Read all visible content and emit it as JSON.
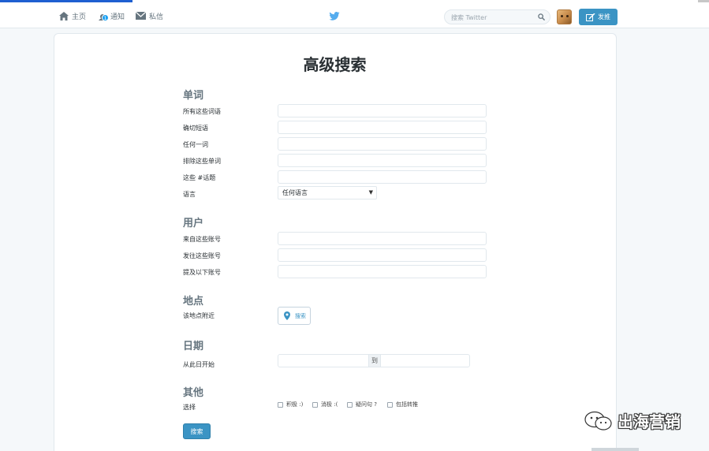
{
  "nav": {
    "home_label": "主页",
    "notifications_label": "通知",
    "notifications_badge": "1",
    "messages_label": "私信"
  },
  "search": {
    "placeholder": "搜索 Twitter"
  },
  "tweet_button_label": "发推",
  "page_title": "高级搜索",
  "sections": {
    "words": {
      "heading": "单词",
      "fields": [
        {
          "label": "所有这些词语",
          "value": ""
        },
        {
          "label": "确切短语",
          "value": ""
        },
        {
          "label": "任何一词",
          "value": ""
        },
        {
          "label": "排除这些单词",
          "value": ""
        },
        {
          "label": "这些 #话题",
          "value": ""
        }
      ],
      "language_label": "语言",
      "language_value": "任何语言"
    },
    "users": {
      "heading": "用户",
      "fields": [
        {
          "label": "来自这些账号",
          "value": ""
        },
        {
          "label": "发往这些账号",
          "value": ""
        },
        {
          "label": "提及以下账号",
          "value": ""
        }
      ]
    },
    "places": {
      "heading": "地点",
      "near_label": "该地点附近",
      "location_button": "搜索"
    },
    "dates": {
      "heading": "日期",
      "from_label": "从此日开始",
      "to_label": "到"
    },
    "other": {
      "heading": "其他",
      "select_label": "选择",
      "options": [
        "积极 :)",
        "消极 :(",
        "疑问句 ?",
        "包括转推"
      ]
    }
  },
  "submit_label": "搜索",
  "watermark_text": "出海营销",
  "colors": {
    "accent": "#3b94c4",
    "twitter_blue": "#1da1f2"
  }
}
